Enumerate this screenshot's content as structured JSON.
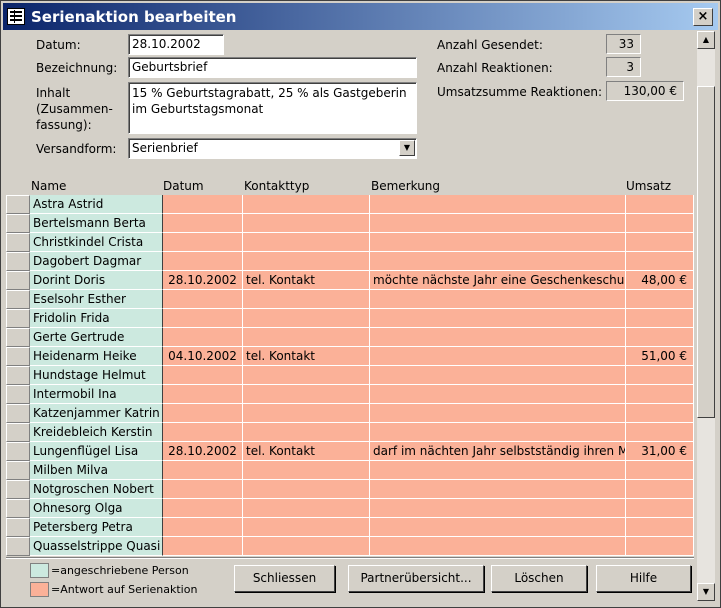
{
  "window": {
    "title": "Serienaktion bearbeiten",
    "close_label": "×"
  },
  "form": {
    "datum_label": "Datum:",
    "datum_value": "28.10.2002",
    "bezeichnung_label": "Bezeichnung:",
    "bezeichnung_value": "Geburtsbrief",
    "inhalt_label": "Inhalt (Zusammen-fassung):",
    "inhalt_value": "15 % Geburtstagrabatt, 25 % als Gastgeberin im Geburtstagsmonat",
    "versandform_label": "Versandform:",
    "versandform_value": "Serienbrief",
    "gesendet_label": "Anzahl Gesendet:",
    "gesendet_value": "33",
    "reaktionen_label": "Anzahl Reaktionen:",
    "reaktionen_value": "3",
    "umsatz_label": "Umsatzsumme Reaktionen:",
    "umsatz_value": "130,00 €"
  },
  "table": {
    "headers": {
      "name": "Name",
      "datum": "Datum",
      "kontakttyp": "Kontakttyp",
      "bemerkung": "Bemerkung",
      "umsatz": "Umsatz"
    },
    "rows": [
      {
        "name": "Astra Astrid",
        "datum": "",
        "kontakttyp": "",
        "bemerkung": "",
        "umsatz": ""
      },
      {
        "name": "Bertelsmann Berta",
        "datum": "",
        "kontakttyp": "",
        "bemerkung": "",
        "umsatz": ""
      },
      {
        "name": "Christkindel Crista",
        "datum": "",
        "kontakttyp": "",
        "bemerkung": "",
        "umsatz": ""
      },
      {
        "name": "Dagobert Dagmar",
        "datum": "",
        "kontakttyp": "",
        "bemerkung": "",
        "umsatz": ""
      },
      {
        "name": "Dorint Doris",
        "datum": "28.10.2002",
        "kontakttyp": "tel. Kontakt",
        "bemerkung": "möchte nächste Jahr eine Geschenkeschulun",
        "umsatz": "48,00 €"
      },
      {
        "name": "Eselsohr Esther",
        "datum": "",
        "kontakttyp": "",
        "bemerkung": "",
        "umsatz": ""
      },
      {
        "name": "Fridolin Frida",
        "datum": "",
        "kontakttyp": "",
        "bemerkung": "",
        "umsatz": ""
      },
      {
        "name": "Gerte Gertrude",
        "datum": "",
        "kontakttyp": "",
        "bemerkung": "",
        "umsatz": ""
      },
      {
        "name": "Heidenarm Heike",
        "datum": "04.10.2002",
        "kontakttyp": "tel. Kontakt",
        "bemerkung": "",
        "umsatz": "51,00 €"
      },
      {
        "name": "Hundstage Helmut",
        "datum": "",
        "kontakttyp": "",
        "bemerkung": "",
        "umsatz": ""
      },
      {
        "name": "Intermobil Ina",
        "datum": "",
        "kontakttyp": "",
        "bemerkung": "",
        "umsatz": ""
      },
      {
        "name": "Katzenjammer Katrin",
        "datum": "",
        "kontakttyp": "",
        "bemerkung": "",
        "umsatz": ""
      },
      {
        "name": "Kreidebleich Kerstin",
        "datum": "",
        "kontakttyp": "",
        "bemerkung": "",
        "umsatz": ""
      },
      {
        "name": "Lungenflügel Lisa",
        "datum": "28.10.2002",
        "kontakttyp": "tel. Kontakt",
        "bemerkung": "darf im nächten Jahr selbstständig ihren Mar",
        "umsatz": "31,00 €"
      },
      {
        "name": "Milben Milva",
        "datum": "",
        "kontakttyp": "",
        "bemerkung": "",
        "umsatz": ""
      },
      {
        "name": "Notgroschen Nobert",
        "datum": "",
        "kontakttyp": "",
        "bemerkung": "",
        "umsatz": ""
      },
      {
        "name": "Ohnesorg Olga",
        "datum": "",
        "kontakttyp": "",
        "bemerkung": "",
        "umsatz": ""
      },
      {
        "name": "Petersberg Petra",
        "datum": "",
        "kontakttyp": "",
        "bemerkung": "",
        "umsatz": ""
      },
      {
        "name": "Quasselstrippe Quasi",
        "datum": "",
        "kontakttyp": "",
        "bemerkung": "",
        "umsatz": ""
      }
    ]
  },
  "legend": {
    "person_label": "=angeschriebene Person",
    "person_color": "#cce9df",
    "response_label": "=Antwort auf Serienaktion",
    "response_color": "#fbb198"
  },
  "buttons": {
    "schliessen": "Schliessen",
    "partner": "Partnerübersicht...",
    "loeschen": "Löschen",
    "hilfe": "Hilfe"
  }
}
